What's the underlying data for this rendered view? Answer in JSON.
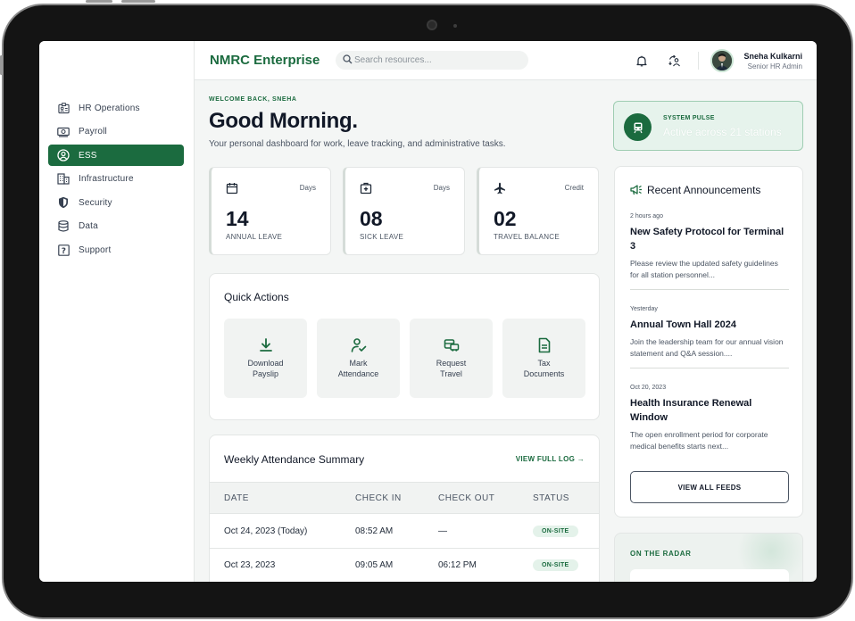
{
  "app": {
    "brand": "NMRC Enterprise",
    "search_placeholder": "Search resources..."
  },
  "user": {
    "name": "Sneha Kulkarni",
    "role": "Senior HR Admin"
  },
  "sidebar": {
    "items": [
      {
        "label": "HR Operations",
        "icon": "id-card-icon"
      },
      {
        "label": "Payroll",
        "icon": "banknote-icon"
      },
      {
        "label": "ESS",
        "icon": "user-circle-icon",
        "active": true
      },
      {
        "label": "Infrastructure",
        "icon": "building-icon"
      },
      {
        "label": "Security",
        "icon": "shield-icon"
      },
      {
        "label": "Data",
        "icon": "database-icon"
      },
      {
        "label": "Support",
        "icon": "help-square-icon"
      }
    ]
  },
  "header": {
    "welcome": "WELCOME BACK, SNEHA",
    "greeting": "Good Morning.",
    "subtitle": "Your personal dashboard for work, leave tracking, and administrative tasks."
  },
  "stats": [
    {
      "icon": "calendar-icon",
      "unit": "Days",
      "value": "14",
      "label": "ANNUAL LEAVE"
    },
    {
      "icon": "medical-kit-icon",
      "unit": "Days",
      "value": "08",
      "label": "SICK LEAVE"
    },
    {
      "icon": "airplane-icon",
      "unit": "Credit",
      "value": "02",
      "label": "TRAVEL BALANCE"
    }
  ],
  "quick_actions": {
    "title": "Quick Actions",
    "items": [
      {
        "label": "Download\nPayslip",
        "icon": "download-icon"
      },
      {
        "label": "Mark\nAttendance",
        "icon": "user-check-icon"
      },
      {
        "label": "Request\nTravel",
        "icon": "car-icon"
      },
      {
        "label": "Tax\nDocuments",
        "icon": "document-icon"
      }
    ]
  },
  "attendance": {
    "title": "Weekly Attendance Summary",
    "link": "VIEW FULL LOG →",
    "columns": [
      "DATE",
      "CHECK IN",
      "CHECK OUT",
      "STATUS"
    ],
    "rows": [
      {
        "date": "Oct 24, 2023 (Today)",
        "check_in": "08:52 AM",
        "check_out": "—",
        "status": "ON-SITE"
      },
      {
        "date": "Oct 23, 2023",
        "check_in": "09:05 AM",
        "check_out": "06:12 PM",
        "status": "ON-SITE"
      }
    ]
  },
  "system_pulse": {
    "label": "SYSTEM PULSE",
    "text": "Active across 21 stations"
  },
  "announcements": {
    "title": "Recent Announcements",
    "items": [
      {
        "time": "2 hours ago",
        "title": "New Safety Protocol for Terminal 3",
        "body": "Please review the updated safety guidelines for all station personnel..."
      },
      {
        "time": "Yesterday",
        "title": "Annual Town Hall 2024",
        "body": "Join the leadership team for our annual vision statement and Q&A session...."
      },
      {
        "time": "Oct 20, 2023",
        "title": "Health Insurance Renewal Window",
        "body": "The open enrollment period for corporate medical benefits starts next..."
      }
    ],
    "button": "VIEW ALL FEEDS"
  },
  "radar": {
    "label": "ON THE RADAR"
  },
  "colors": {
    "accent": "#1b6b3f",
    "accent_light": "#e6f3ec",
    "background": "#f4f6f5"
  }
}
